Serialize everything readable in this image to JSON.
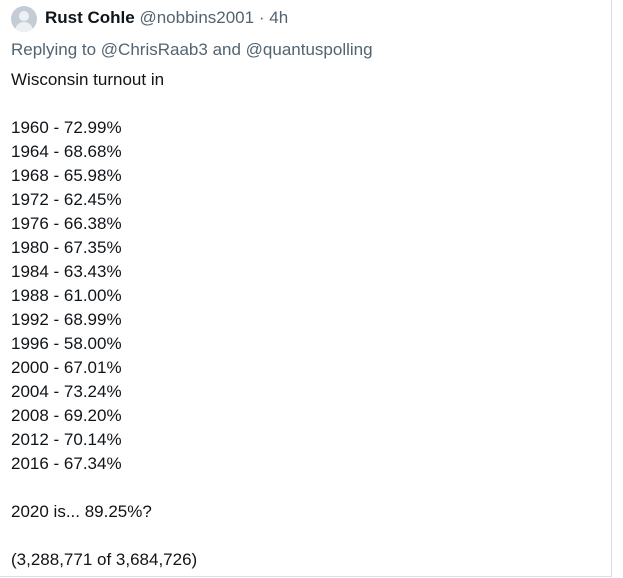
{
  "tweet": {
    "author_name": "Rust Cohle",
    "author_handle": "@nobbins2001",
    "separator": "·",
    "time": "4h",
    "reply_prefix": "Replying to",
    "reply_user_1": "@ChrisRaab3",
    "reply_and": "and",
    "reply_user_2": "@quantuspolling",
    "intro": "Wisconsin turnout in",
    "turnout_lines": [
      "1960 - 72.99%",
      "1964 - 68.68%",
      "1968 - 65.98%",
      "1972 - 62.45%",
      "1976 - 66.38%",
      "1980 - 67.35%",
      "1984 - 63.43%",
      "1988 - 61.00%",
      "1992 - 68.99%",
      "1996 - 58.00%",
      "2000 - 67.01%",
      "2004 - 73.24%",
      "2008 - 69.20%",
      "2012 - 70.14%",
      "2016 - 67.34%"
    ],
    "question": "2020 is... 89.25%?",
    "votes_note": "(3,288,771 of 3,684,726)"
  }
}
